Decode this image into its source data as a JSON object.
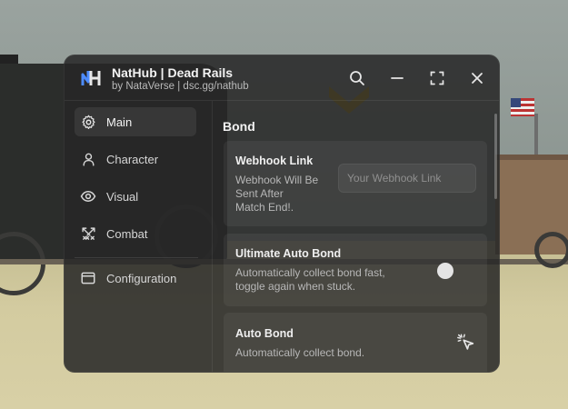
{
  "window": {
    "title": "NatHub | Dead Rails",
    "subtitle": "by NataVerse | dsc.gg/nathub",
    "accent_color": "#4d8cff"
  },
  "titlebar_buttons": [
    {
      "name": "search-icon"
    },
    {
      "name": "minimize-icon"
    },
    {
      "name": "maximize-icon"
    },
    {
      "name": "close-icon"
    }
  ],
  "sidebar": {
    "items": [
      {
        "label": "Main",
        "icon": "gear-icon",
        "active": true
      },
      {
        "label": "Character",
        "icon": "person-icon",
        "active": false
      },
      {
        "label": "Visual",
        "icon": "eye-icon",
        "active": false
      },
      {
        "label": "Combat",
        "icon": "swords-icon",
        "active": false
      },
      {
        "label": "Configuration",
        "icon": "window-icon",
        "active": false
      }
    ]
  },
  "main": {
    "section_title": "Bond",
    "webhook": {
      "title": "Webhook Link",
      "description": "Webhook Will Be Sent After Match End!.",
      "desc_line1": "Webhook Will Be",
      "desc_line2": "Sent After",
      "desc_line3": "Match End!.",
      "input_value": "",
      "placeholder": "Your Webhook Link"
    },
    "ultimate_auto_bond": {
      "title": "Ultimate Auto Bond",
      "desc_line1": "Automatically collect bond fast,",
      "desc_line2": "toggle again when stuck.",
      "enabled": false
    },
    "auto_bond": {
      "title": "Auto Bond",
      "description": "Automatically collect bond.",
      "icon": "pointer-click-icon"
    }
  }
}
